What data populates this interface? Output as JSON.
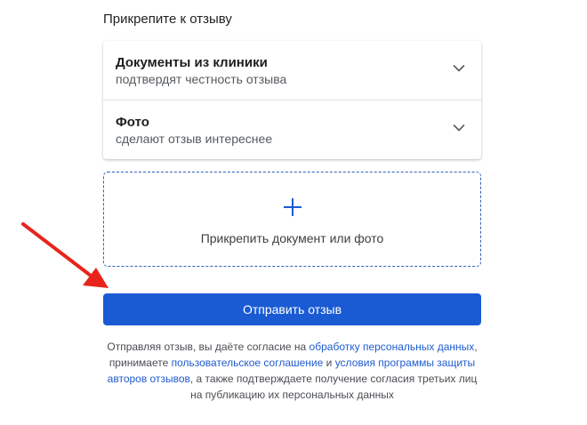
{
  "section_title": "Прикрепите к отзыву",
  "attachments": [
    {
      "title": "Документы из клиники",
      "subtitle": "подтвердят честность отзыва",
      "icon": "chevron-down-icon"
    },
    {
      "title": "Фото",
      "subtitle": "сделают отзыв интереснее",
      "icon": "chevron-down-icon"
    }
  ],
  "upload": {
    "icon": "plus-icon",
    "label": "Прикрепить документ или фото"
  },
  "submit_label": "Отправить отзыв",
  "consent": {
    "t1": "Отправляя отзыв, вы даёте согласие на ",
    "link1": "обработку персональных данных",
    "t2": ", принимаете ",
    "link2": "пользовательское соглашение",
    "t3": " и ",
    "link3": "условия программы защиты авторов отзывов",
    "t4": ", а также подтверждаете получение согласия третьих лиц на публикацию их персональных данных"
  },
  "colors": {
    "accent": "#1a5bd4",
    "link": "#1f5ccf",
    "annotation_arrow": "#e8241c"
  }
}
